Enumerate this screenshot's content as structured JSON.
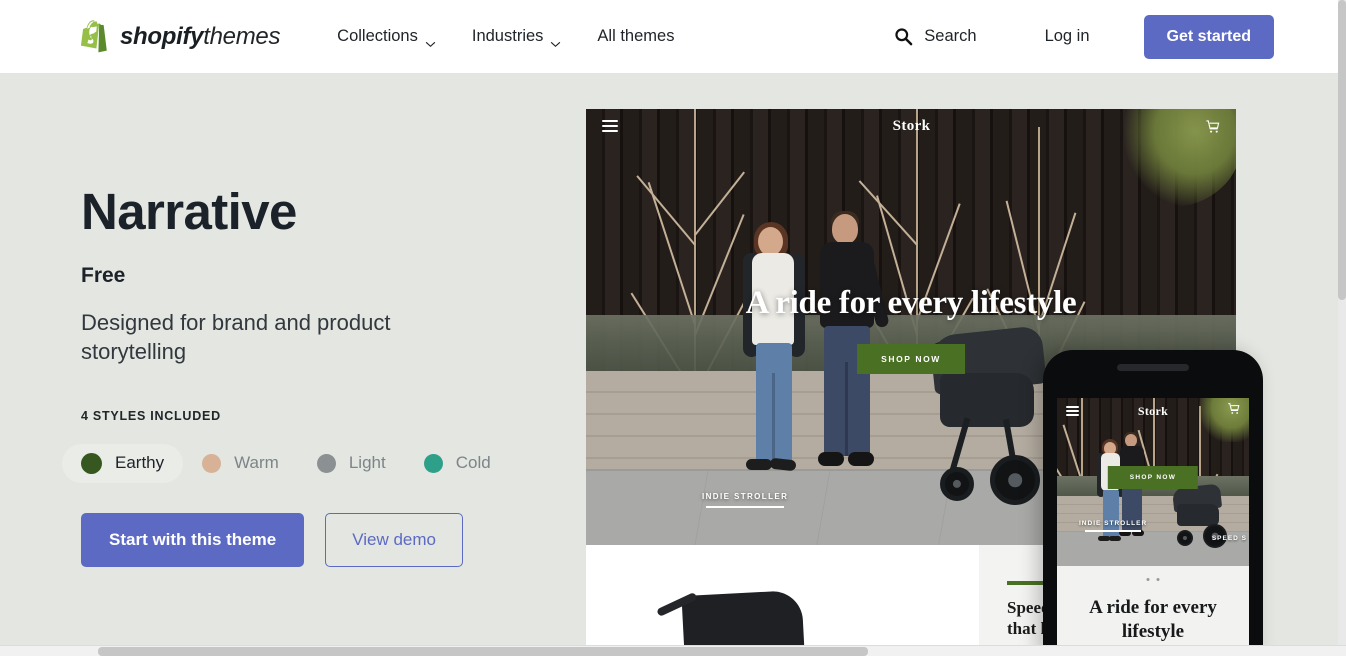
{
  "navbar": {
    "brand": {
      "bold": "shopify",
      "light": "themes",
      "logo_icon": "shopify-bag-icon"
    },
    "links": [
      {
        "label": "Collections",
        "has_chevron": true
      },
      {
        "label": "Industries",
        "has_chevron": true
      },
      {
        "label": "All themes",
        "has_chevron": false
      }
    ],
    "search_label": "Search",
    "search_icon": "search-icon",
    "login_label": "Log in",
    "cta_label": "Get started"
  },
  "theme": {
    "title": "Narrative",
    "price": "Free",
    "description": "Designed for brand and product storytelling",
    "styles_label": "4 STYLES INCLUDED",
    "styles": [
      {
        "name": "Earthy",
        "color": "#36571f",
        "selected": true
      },
      {
        "name": "Warm",
        "color": "#d8b296",
        "selected": false
      },
      {
        "name": "Light",
        "color": "#8b9093",
        "selected": false
      },
      {
        "name": "Cold",
        "color": "#2ea089",
        "selected": false
      }
    ],
    "primary_cta": "Start with this theme",
    "secondary_cta": "View demo"
  },
  "preview": {
    "store_name": "Stork",
    "menu_icon": "hamburger-menu-icon",
    "cart_icon": "shopping-cart-icon",
    "hero_title": "A ride for every lifestyle",
    "shop_now": "SHOP NOW",
    "product_tag": "INDIE STROLLER",
    "feature_heading_line1": "Speed: A j",
    "feature_heading_line2": "that keeps"
  },
  "mobile_preview": {
    "store_name": "Stork",
    "menu_icon": "hamburger-menu-icon",
    "cart_icon": "shopping-cart-icon",
    "shop_now": "SHOP NOW",
    "product_tag": "INDIE STROLLER",
    "product_tag2": "SPEED S",
    "caption": "A ride for every lifestyle"
  },
  "colors": {
    "accent": "#5c6ac4",
    "page_background": "#e3e6e1",
    "navbar_background": "#ffffff",
    "shop_now_green": "#4a7024",
    "heading": "#1c2229"
  }
}
